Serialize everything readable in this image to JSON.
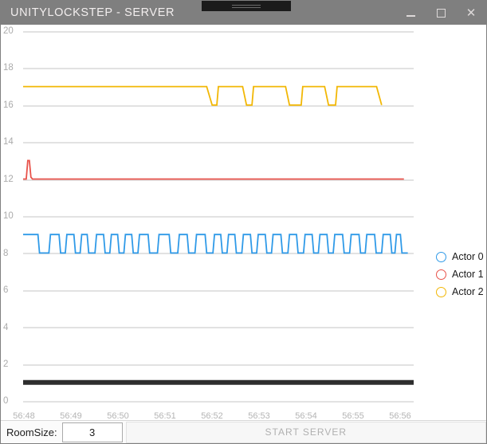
{
  "window": {
    "title": "UNITYLOCKSTEP - SERVER",
    "buttons": {
      "minimize": "minimize-button",
      "maximize": "maximize-button",
      "close": "✕"
    }
  },
  "legend": {
    "items": [
      {
        "label": "Actor 0",
        "color": "#2f9ae8"
      },
      {
        "label": "Actor 1",
        "color": "#e8524a"
      },
      {
        "label": "Actor 2",
        "color": "#f2b705"
      }
    ]
  },
  "bottom": {
    "roomsize_label": "RoomSize:",
    "roomsize_value": "3",
    "roomsize_placeholder": "3",
    "start_button_label": "START SERVER"
  },
  "chart_data": {
    "type": "line",
    "title": "",
    "xlabel": "",
    "ylabel": "",
    "grid": true,
    "legend_position": "right",
    "ylim": [
      0,
      20
    ],
    "yticks": [
      0,
      2,
      4,
      6,
      8,
      10,
      12,
      14,
      16,
      18,
      20
    ],
    "xticks": [
      "56:48",
      "56:49",
      "56:50",
      "56:51",
      "56:52",
      "56:53",
      "56:54",
      "56:55",
      "56:56"
    ],
    "xlim": [
      "56:48",
      "56:56"
    ],
    "series": [
      {
        "name": "Actor 0",
        "color": "#2f9ae8",
        "baseline": 8,
        "peak": 9,
        "notes": "square-wave oscillation between 8 and 9 across the whole visible range, ending near 56:55.7",
        "points": [
          [
            0.0,
            9
          ],
          [
            0.038,
            9
          ],
          [
            0.042,
            8
          ],
          [
            0.066,
            8
          ],
          [
            0.07,
            9
          ],
          [
            0.092,
            9
          ],
          [
            0.096,
            8
          ],
          [
            0.108,
            8
          ],
          [
            0.112,
            9
          ],
          [
            0.13,
            9
          ],
          [
            0.134,
            8
          ],
          [
            0.146,
            8
          ],
          [
            0.15,
            9
          ],
          [
            0.164,
            9
          ],
          [
            0.168,
            8
          ],
          [
            0.184,
            8
          ],
          [
            0.188,
            9
          ],
          [
            0.206,
            9
          ],
          [
            0.21,
            8
          ],
          [
            0.222,
            8
          ],
          [
            0.226,
            9
          ],
          [
            0.242,
            9
          ],
          [
            0.246,
            8
          ],
          [
            0.258,
            8
          ],
          [
            0.262,
            9
          ],
          [
            0.278,
            9
          ],
          [
            0.282,
            8
          ],
          [
            0.294,
            8
          ],
          [
            0.298,
            9
          ],
          [
            0.32,
            9
          ],
          [
            0.324,
            8
          ],
          [
            0.344,
            8
          ],
          [
            0.348,
            9
          ],
          [
            0.374,
            9
          ],
          [
            0.378,
            8
          ],
          [
            0.396,
            8
          ],
          [
            0.4,
            9
          ],
          [
            0.42,
            9
          ],
          [
            0.424,
            8
          ],
          [
            0.44,
            8
          ],
          [
            0.444,
            9
          ],
          [
            0.466,
            9
          ],
          [
            0.47,
            8
          ],
          [
            0.486,
            8
          ],
          [
            0.49,
            9
          ],
          [
            0.506,
            9
          ],
          [
            0.51,
            8
          ],
          [
            0.522,
            8
          ],
          [
            0.526,
            9
          ],
          [
            0.542,
            9
          ],
          [
            0.546,
            8
          ],
          [
            0.56,
            8
          ],
          [
            0.564,
            9
          ],
          [
            0.582,
            9
          ],
          [
            0.586,
            8
          ],
          [
            0.598,
            8
          ],
          [
            0.602,
            9
          ],
          [
            0.62,
            9
          ],
          [
            0.624,
            8
          ],
          [
            0.636,
            8
          ],
          [
            0.64,
            9
          ],
          [
            0.66,
            9
          ],
          [
            0.664,
            8
          ],
          [
            0.678,
            8
          ],
          [
            0.682,
            9
          ],
          [
            0.7,
            9
          ],
          [
            0.704,
            8
          ],
          [
            0.718,
            8
          ],
          [
            0.722,
            9
          ],
          [
            0.74,
            9
          ],
          [
            0.744,
            8
          ],
          [
            0.756,
            8
          ],
          [
            0.76,
            9
          ],
          [
            0.778,
            9
          ],
          [
            0.782,
            8
          ],
          [
            0.794,
            8
          ],
          [
            0.798,
            9
          ],
          [
            0.818,
            9
          ],
          [
            0.822,
            8
          ],
          [
            0.836,
            8
          ],
          [
            0.84,
            9
          ],
          [
            0.86,
            9
          ],
          [
            0.864,
            8
          ],
          [
            0.876,
            8
          ],
          [
            0.88,
            9
          ],
          [
            0.9,
            9
          ],
          [
            0.904,
            8
          ],
          [
            0.918,
            8
          ],
          [
            0.922,
            9
          ],
          [
            0.94,
            9
          ],
          [
            0.944,
            8
          ],
          [
            0.952,
            8
          ],
          [
            0.956,
            9
          ],
          [
            0.966,
            9
          ],
          [
            0.97,
            8
          ],
          [
            0.985,
            8
          ]
        ]
      },
      {
        "name": "Actor 1",
        "color": "#e8524a",
        "baseline": 12,
        "peak": 13,
        "notes": "flat at 12 with one narrow spike to 13 right after the start, ends near 56:55.6",
        "points": [
          [
            0.0,
            12
          ],
          [
            0.008,
            12
          ],
          [
            0.012,
            13
          ],
          [
            0.016,
            13
          ],
          [
            0.02,
            12.1
          ],
          [
            0.024,
            12
          ],
          [
            0.975,
            12
          ]
        ]
      },
      {
        "name": "Actor 2",
        "color": "#f2b705",
        "baseline": 17,
        "peak": 16,
        "notes": "flat at 17 from the start; five brief dips to 16 between 56:51.8 and 56:55.5; drops to 16 at the end",
        "points": [
          [
            0.0,
            17
          ],
          [
            0.47,
            17
          ],
          [
            0.484,
            16
          ],
          [
            0.496,
            16
          ],
          [
            0.5,
            17
          ],
          [
            0.562,
            17
          ],
          [
            0.572,
            16
          ],
          [
            0.586,
            16
          ],
          [
            0.59,
            17
          ],
          [
            0.672,
            17
          ],
          [
            0.682,
            16
          ],
          [
            0.712,
            16
          ],
          [
            0.716,
            17
          ],
          [
            0.772,
            17
          ],
          [
            0.782,
            16
          ],
          [
            0.8,
            16
          ],
          [
            0.804,
            17
          ],
          [
            0.905,
            17
          ],
          [
            0.918,
            16
          ]
        ]
      },
      {
        "name": "baseline-bar",
        "color": "#2e2e2e",
        "baseline": 1,
        "peak": 1,
        "notes": "thick dark horizontal bar at y = 1 spanning the full plot width",
        "points": [
          [
            0.0,
            1
          ],
          [
            1.0,
            1
          ]
        ]
      }
    ]
  }
}
